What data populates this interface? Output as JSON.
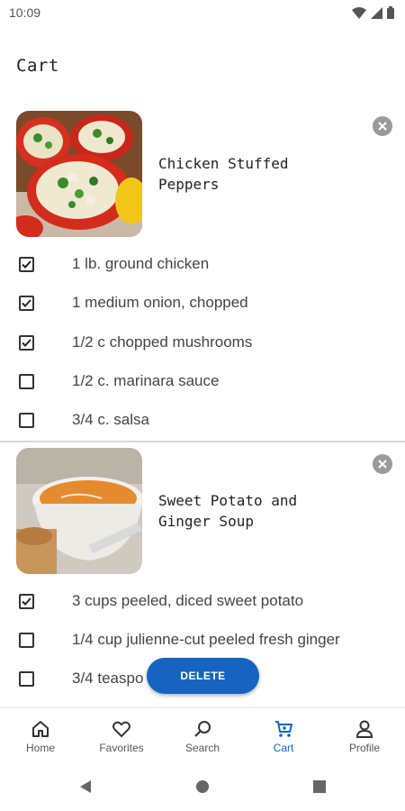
{
  "status": {
    "time": "10:09"
  },
  "page": {
    "title": "Cart"
  },
  "recipes": [
    {
      "title": "Chicken Stuffed\nPeppers",
      "ingredients": [
        {
          "label": "1 lb. ground chicken",
          "checked": true
        },
        {
          "label": "1 medium onion, chopped",
          "checked": true
        },
        {
          "label": "1/2 c chopped mushrooms",
          "checked": true
        },
        {
          "label": "1/2 c. marinara sauce",
          "checked": false
        },
        {
          "label": "3/4 c. salsa",
          "checked": false
        }
      ]
    },
    {
      "title": "Sweet Potato and\nGinger Soup",
      "ingredients": [
        {
          "label": "3 cups peeled, diced sweet potato",
          "checked": true
        },
        {
          "label": "1/4 cup julienne-cut peeled fresh ginger",
          "checked": false
        },
        {
          "label": "3/4 teaspo",
          "checked": false
        }
      ]
    }
  ],
  "fab": {
    "label": "DELETE"
  },
  "nav": {
    "items": [
      {
        "label": "Home",
        "icon": "home-icon"
      },
      {
        "label": "Favorites",
        "icon": "heart-icon"
      },
      {
        "label": "Search",
        "icon": "search-icon"
      },
      {
        "label": "Cart",
        "icon": "cart-icon",
        "active": true
      },
      {
        "label": "Profile",
        "icon": "person-icon"
      }
    ],
    "active_color": "#1664c0"
  }
}
